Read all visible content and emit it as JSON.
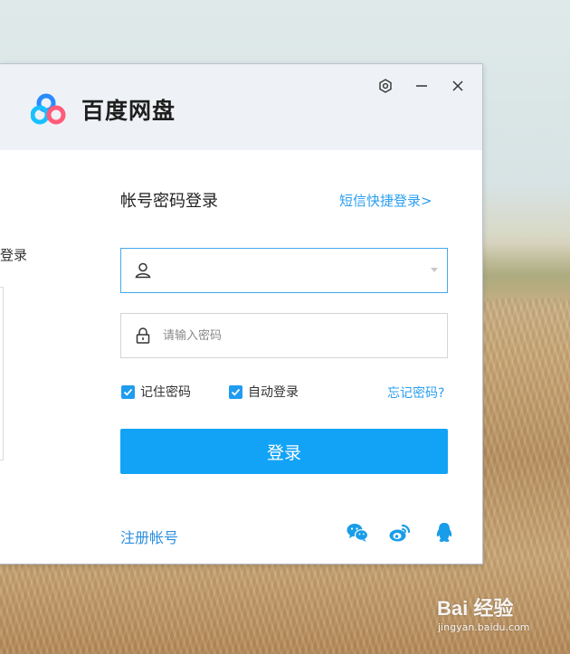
{
  "app": {
    "name": "百度网盘"
  },
  "left_panel": {
    "partial_label": "登录"
  },
  "login": {
    "title": "帐号密码登录",
    "sms_link": "短信快捷登录>",
    "username": {
      "value": "",
      "placeholder": ""
    },
    "password": {
      "value": "",
      "placeholder": "请输入密码"
    },
    "remember_label": "记住密码",
    "remember_checked": true,
    "autologin_label": "自动登录",
    "autologin_checked": true,
    "forgot_label": "忘记密码?",
    "submit_label": "登录",
    "register_label": "注册帐号"
  },
  "social": [
    "wechat-icon",
    "weibo-icon",
    "qq-icon"
  ],
  "watermark": {
    "main": "Bai 经验",
    "sub": "jingyan.baidu.com"
  },
  "colors": {
    "accent": "#12a3f7",
    "link": "#2b9ff0",
    "titlebar": "#eef2f6"
  }
}
